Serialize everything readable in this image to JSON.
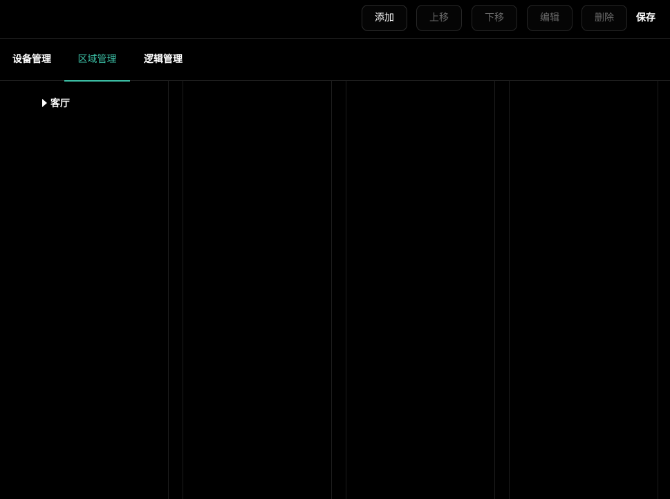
{
  "toolbar": {
    "add_label": "添加",
    "move_up_label": "上移",
    "move_down_label": "下移",
    "edit_label": "编辑",
    "delete_label": "删除",
    "save_label": "保存"
  },
  "tabs": [
    {
      "label": "设备管理"
    },
    {
      "label": "区域管理"
    },
    {
      "label": "逻辑管理"
    }
  ],
  "tree": {
    "nodes": [
      {
        "label": "客厅",
        "expanded": false
      }
    ]
  },
  "colors": {
    "background": "#000000",
    "accent": "#3cc0a6",
    "divider": "#1e1e1e",
    "disabled_text": "#6a6a6a"
  }
}
